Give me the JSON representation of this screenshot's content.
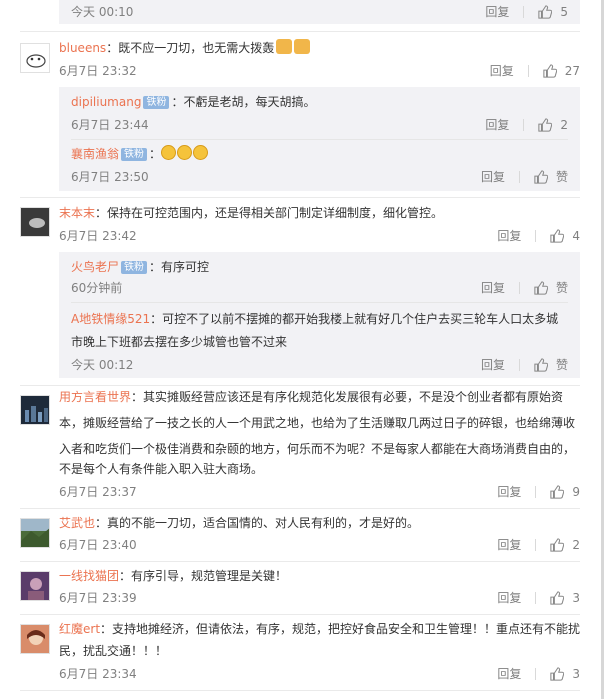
{
  "ui": {
    "reply": "回复",
    "like_zan": "赞",
    "badge": "铁粉"
  },
  "top": {
    "time": "今天 00:10",
    "likes": "5"
  },
  "c1": {
    "name": "blueens",
    "text": "：既不应一刀切，也无需大拨轰",
    "time": "6月7日 23:32",
    "likes": "27",
    "replies": [
      {
        "name": "dipiliumang",
        "text": "：不虧是老胡，每天胡搞。",
        "time": "6月7日 23:44",
        "likes": "2"
      },
      {
        "name": "襄南渔翁",
        "text": "：",
        "time": "6月7日 23:50"
      }
    ]
  },
  "c2": {
    "name": "末本末",
    "text": "：保持在可控范围内，还是得相关部门制定详细制度，细化管控。",
    "time": "6月7日 23:42",
    "likes": "4",
    "replies": [
      {
        "name": "火鸟老尸",
        "text": "：有序可控",
        "time": "60分钟前"
      },
      {
        "name": "A地铁情缘521",
        "text1": "：可控不了以前不摆摊的都开始我楼上就有好几个住户去买三轮车人口太多城",
        "text2": "市晚上下班都去摆在多少城管也管不过来",
        "time": "今天 00:12"
      }
    ]
  },
  "c3": {
    "name": "用方言看世界",
    "l1": "：其实摊贩经营应该还是有序化规范化发展很有必要，不是没个创业者都有原始资",
    "l2": "本，摊贩经营给了一技之长的人一个用武之地，也给为了生活赚取几两过日子的碎银，也给绵薄收",
    "l3": "入者和吃货们一个极佳消费和杂颐的地方，何乐而不为呢？不是每家人都能在大商场消费自由的，",
    "l4": "不是每个人有条件能入职入驻大商场。",
    "time": "6月7日 23:37",
    "likes": "9"
  },
  "c4": {
    "name": "艾武也",
    "text": "：真的不能一刀切，适合国情的、对人民有利的，才是好的。",
    "time": "6月7日 23:40",
    "likes": "2"
  },
  "c5": {
    "name": "一线找猫团",
    "text": "：有序引导，规范管理是关键！",
    "time": "6月7日 23:39",
    "likes": "3"
  },
  "c6": {
    "name": "红魔ert",
    "l1": "：支持地摊经济，但请依法，有序，规范，把控好食品安全和卫生管理！！重点还有不能扰",
    "l2": "民，扰乱交通！！！",
    "time": "6月7日 23:34",
    "likes": "3"
  }
}
